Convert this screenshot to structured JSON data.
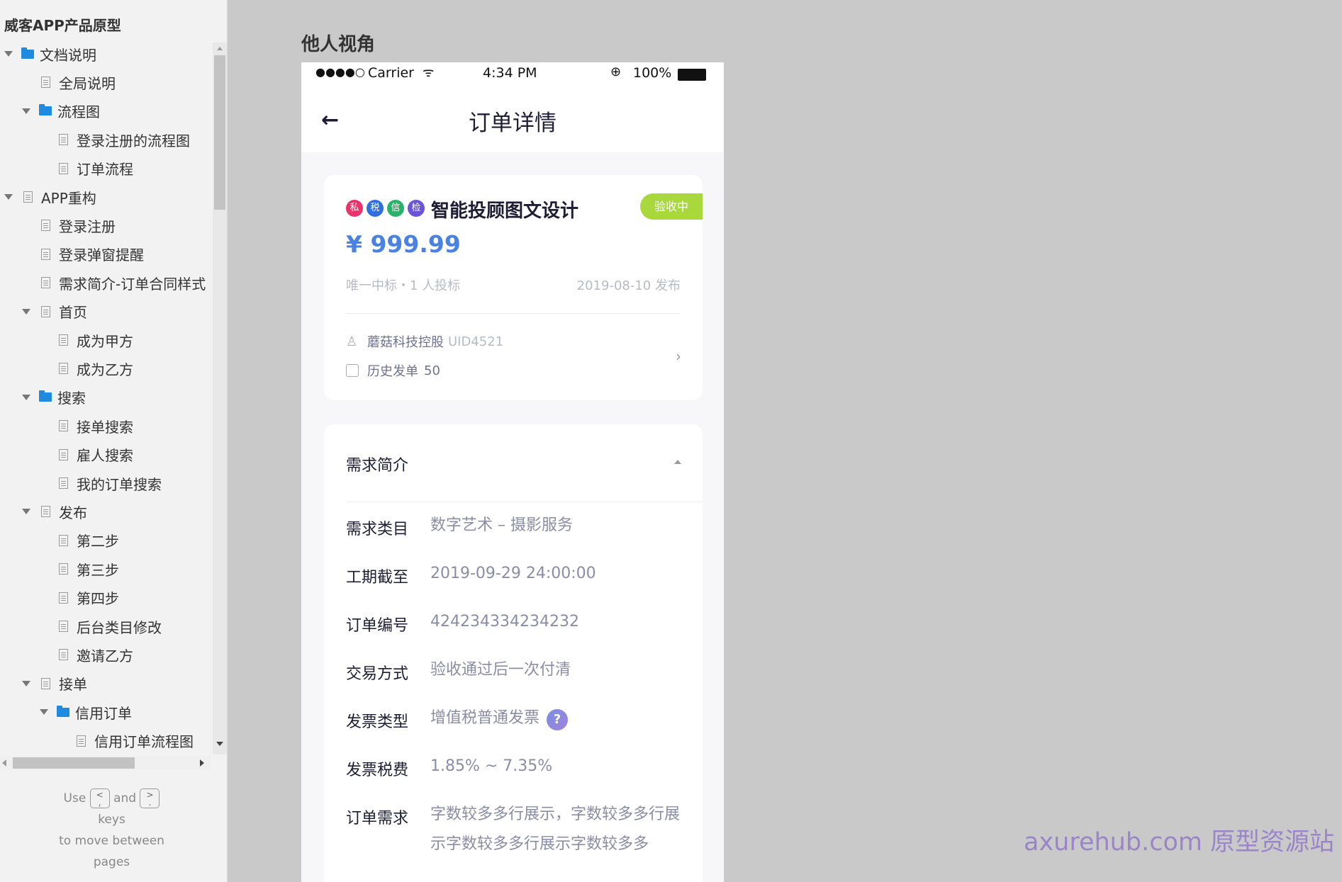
{
  "sidebar": {
    "project_title": "威客APP产品原型",
    "items": [
      {
        "label": "文档说明",
        "level": 0,
        "type": "folder",
        "expanded": true
      },
      {
        "label": "全局说明",
        "level": 1,
        "type": "page"
      },
      {
        "label": "流程图",
        "level": 1,
        "type": "folder",
        "expanded": true
      },
      {
        "label": "登录注册的流程图",
        "level": 2,
        "type": "page"
      },
      {
        "label": "订单流程",
        "level": 2,
        "type": "page"
      },
      {
        "label": "APP重构",
        "level": 0,
        "type": "page",
        "expanded": true
      },
      {
        "label": "登录注册",
        "level": 1,
        "type": "page"
      },
      {
        "label": "登录弹窗提醒",
        "level": 1,
        "type": "page"
      },
      {
        "label": "需求简介-订单合同样式",
        "level": 1,
        "type": "page"
      },
      {
        "label": "首页",
        "level": 1,
        "type": "page",
        "expanded": true
      },
      {
        "label": "成为甲方",
        "level": 2,
        "type": "page"
      },
      {
        "label": "成为乙方",
        "level": 2,
        "type": "page"
      },
      {
        "label": "搜索",
        "level": 1,
        "type": "folder",
        "expanded": true
      },
      {
        "label": "接单搜索",
        "level": 2,
        "type": "page"
      },
      {
        "label": "雇人搜索",
        "level": 2,
        "type": "page"
      },
      {
        "label": "我的订单搜索",
        "level": 2,
        "type": "page"
      },
      {
        "label": "发布",
        "level": 1,
        "type": "page",
        "expanded": true
      },
      {
        "label": "第二步",
        "level": 2,
        "type": "page"
      },
      {
        "label": "第三步",
        "level": 2,
        "type": "page"
      },
      {
        "label": "第四步",
        "level": 2,
        "type": "page"
      },
      {
        "label": "后台类目修改",
        "level": 2,
        "type": "page"
      },
      {
        "label": "邀请乙方",
        "level": 2,
        "type": "page"
      },
      {
        "label": "接单",
        "level": 1,
        "type": "page",
        "expanded": true
      },
      {
        "label": "信用订单",
        "level": 2,
        "type": "folder",
        "expanded": true
      },
      {
        "label": "信用订单流程图",
        "level": 3,
        "type": "page"
      }
    ],
    "hint": {
      "use": "Use",
      "key_prev": "<\n,",
      "and": "and",
      "key_next": ">\n.",
      "keys": "keys",
      "move": "to move between",
      "pages": "pages"
    }
  },
  "main": {
    "view_title": "他人视角"
  },
  "phone": {
    "status_bar": {
      "signal": "●●●●○",
      "carrier": "Carrier",
      "time": "4:34 PM",
      "battery": "100%"
    },
    "nav": {
      "title": "订单详情"
    },
    "order": {
      "badges": [
        {
          "label": "私",
          "color": "#e8336b"
        },
        {
          "label": "税",
          "color": "#2f6fe0"
        },
        {
          "label": "信",
          "color": "#29b36a"
        },
        {
          "label": "检",
          "color": "#6a55d8"
        }
      ],
      "title": "智能投顾图文设计",
      "status": "验收中",
      "price": "¥ 999.99",
      "bid_info": "唯一中标・1 人投标",
      "publish_date": "2019-08-10 发布",
      "publisher": "蘑菇科技控股",
      "uid": "UID4521",
      "history_label": "历史发单",
      "history_count": "50"
    },
    "section": {
      "title": "需求简介",
      "fields": [
        {
          "label": "需求类目",
          "value": "数字艺术 – 摄影服务"
        },
        {
          "label": "工期截至",
          "value": "2019-09-29 24:00:00"
        },
        {
          "label": "订单编号",
          "value": "424234334234232"
        },
        {
          "label": "交易方式",
          "value": "验收通过后一次付清"
        },
        {
          "label": "发票类型",
          "value": "增值税普通发票"
        },
        {
          "label": "发票税费",
          "value": "1.85% ~ 7.35%"
        },
        {
          "label": "订单需求",
          "value": "字数较多多行展示，字数较多多行展示字数较多多行展示字数较多多"
        }
      ]
    }
  },
  "watermark": "axurehub.com 原型资源站"
}
